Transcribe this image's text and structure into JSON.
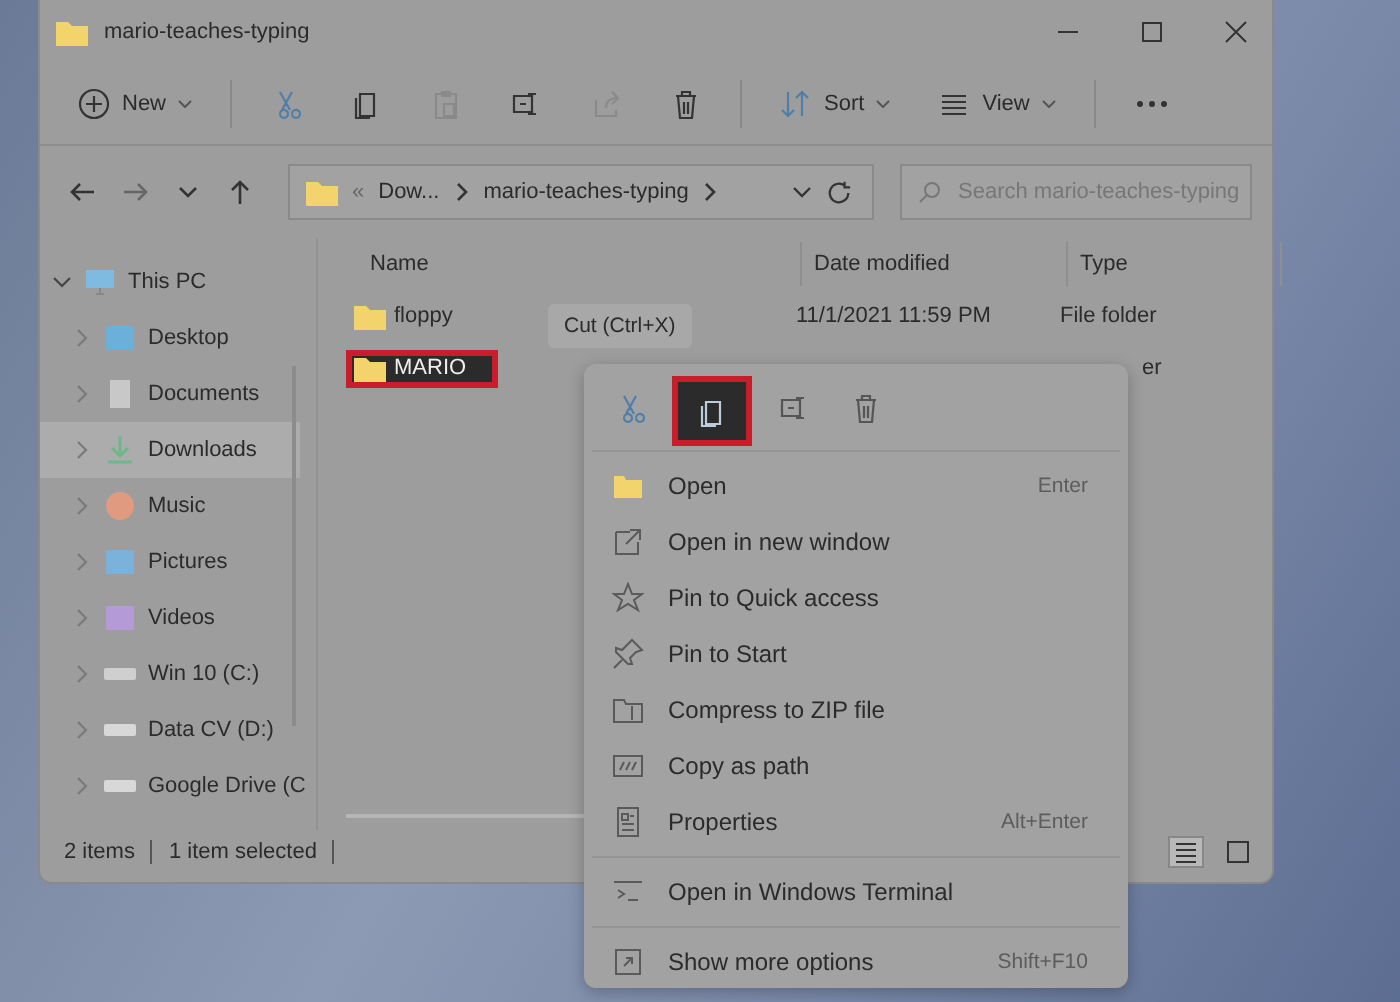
{
  "window": {
    "title": "mario-teaches-typing"
  },
  "toolbar": [
    {
      "kind": "new",
      "label": "New",
      "disabled": false
    },
    {
      "kind": "cut",
      "disabled": false
    },
    {
      "kind": "copy",
      "disabled": false
    },
    {
      "kind": "paste",
      "disabled": true
    },
    {
      "kind": "rename",
      "disabled": false
    },
    {
      "kind": "share",
      "disabled": true
    },
    {
      "kind": "delete",
      "disabled": false
    },
    {
      "kind": "sort",
      "label": "Sort",
      "disabled": false
    },
    {
      "kind": "view",
      "label": "View",
      "disabled": false
    },
    {
      "kind": "more",
      "disabled": false
    }
  ],
  "address": {
    "overflow": "«",
    "crumbs": [
      "Dow...",
      "mario-teaches-typing"
    ]
  },
  "search": {
    "placeholder": "Search mario-teaches-typing"
  },
  "sidebar": {
    "items": [
      {
        "kind": "pc",
        "label": "This PC",
        "expanded": true,
        "selected": false,
        "children": [
          {
            "kind": "desktop",
            "label": "Desktop",
            "expanded": false,
            "selected": false
          },
          {
            "kind": "documents",
            "label": "Documents",
            "expanded": false,
            "selected": false
          },
          {
            "kind": "downloads",
            "label": "Downloads",
            "expanded": false,
            "selected": true
          },
          {
            "kind": "music",
            "label": "Music",
            "expanded": false,
            "selected": false
          },
          {
            "kind": "pictures",
            "label": "Pictures",
            "expanded": false,
            "selected": false
          },
          {
            "kind": "videos",
            "label": "Videos",
            "expanded": false,
            "selected": false
          },
          {
            "kind": "system-drive",
            "label": "Win 10 (C:)",
            "expanded": false,
            "selected": false
          },
          {
            "kind": "drive",
            "label": "Data CV (D:)",
            "expanded": false,
            "selected": false
          },
          {
            "kind": "drive",
            "label": "Google Drive (C",
            "expanded": false,
            "selected": false
          }
        ]
      }
    ]
  },
  "table": {
    "columns": [
      "Name",
      "Date modified",
      "Type"
    ],
    "rows": [
      {
        "name": "floppy",
        "date": "11/1/2021 11:59 PM",
        "type": "File folder",
        "selected": false
      },
      {
        "name": "MARIO",
        "type_visible_end": "er",
        "selected": true
      }
    ]
  },
  "tooltip": "Cut (Ctrl+X)",
  "status_bar": {
    "count": "2 items",
    "selection": "1 item selected",
    "views": [
      {
        "kind": "details",
        "selected": true
      },
      {
        "kind": "tiles",
        "selected": false
      }
    ]
  },
  "context_menu": {
    "actions": [
      {
        "kind": "cut",
        "highlighted": false
      },
      {
        "kind": "copy",
        "highlighted": true
      },
      {
        "kind": "rename",
        "highlighted": false
      },
      {
        "kind": "delete",
        "highlighted": false
      }
    ],
    "groups": [
      [
        {
          "kind": "open",
          "label": "Open",
          "shortcut": "Enter"
        },
        {
          "kind": "new-window",
          "label": "Open in new window"
        },
        {
          "kind": "star",
          "label": "Pin to Quick access"
        },
        {
          "kind": "pin",
          "label": "Pin to Start"
        },
        {
          "kind": "zip",
          "label": "Compress to ZIP file"
        },
        {
          "kind": "path",
          "label": "Copy as path"
        },
        {
          "kind": "properties",
          "label": "Properties",
          "shortcut": "Alt+Enter"
        }
      ],
      [
        {
          "kind": "terminal",
          "label": "Open in Windows Terminal"
        }
      ],
      [
        {
          "kind": "more",
          "label": "Show more options",
          "shortcut": "Shift+F10"
        }
      ]
    ]
  }
}
